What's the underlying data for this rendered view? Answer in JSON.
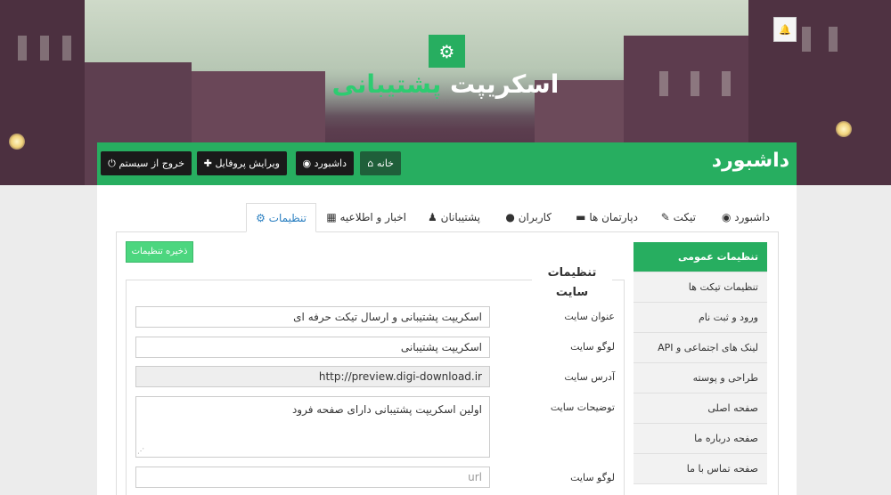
{
  "hero": {
    "gear_icon": "gear-icon",
    "title_main": "اسکریپت",
    "title_accent": "پشتیبانی",
    "bell_icon": "bell-icon"
  },
  "header": {
    "title": "داشبورد",
    "buttons": [
      {
        "label": "خانه",
        "icon": "home-icon",
        "glyph": "⌂"
      },
      {
        "label": "داشبورد",
        "icon": "dashboard-icon",
        "glyph": "◉"
      },
      {
        "label": "ویرایش پروفایل",
        "icon": "user-plus-icon",
        "glyph": "✚"
      },
      {
        "label": "خروج از سیستم",
        "icon": "power-icon",
        "glyph": "⏻"
      }
    ]
  },
  "tabs": [
    {
      "label": "داشبورد",
      "icon": "dashboard-icon",
      "glyph": "◉"
    },
    {
      "label": "تیکت",
      "icon": "ticket-icon",
      "glyph": "✎"
    },
    {
      "label": "دپارتمان ها",
      "icon": "folder-icon",
      "glyph": "▬"
    },
    {
      "label": "کاربران",
      "icon": "user-icon",
      "glyph": "●"
    },
    {
      "label": "پشتیبانان",
      "icon": "support-agent-icon",
      "glyph": "♟"
    },
    {
      "label": "اخبار و اطلاعیه",
      "icon": "cubes-icon",
      "glyph": "▦"
    },
    {
      "label": "تنظیمات",
      "icon": "gear-icon",
      "glyph": "⚙"
    }
  ],
  "sidebar": {
    "items": [
      {
        "label": "تنظیمات عمومی",
        "active": true
      },
      {
        "label": "تنظیمات تیکت ها"
      },
      {
        "label": "ورود و ثبت نام"
      },
      {
        "label": "لینک های اجتماعی و API"
      },
      {
        "label": "طراحی و پوسته"
      },
      {
        "label": "صفحه اصلی"
      },
      {
        "label": "صفحه درباره ما"
      },
      {
        "label": "صفحه تماس با ما"
      }
    ]
  },
  "form": {
    "save_label": "ذخیره تنظیمات",
    "legend": "تنظیمات سایت",
    "fields": [
      {
        "label": "عنوان سایت",
        "value": "اسکریپت پشتیبانی و ارسال تیکت حرفه ای"
      },
      {
        "label": "لوگو سایت",
        "value": "اسکریپت پشتیبانی"
      },
      {
        "label": "آدرس سایت",
        "value": "http://preview.digi-download.ir"
      },
      {
        "label": "توضیحات سایت",
        "value": "اولین اسکریپت پشتیبانی دارای صفحه فرود"
      },
      {
        "label": "لوگو سایت",
        "placeholder": "url"
      }
    ]
  },
  "colors": {
    "accent": "#27ae60",
    "tab_active": "#2a7fc1"
  }
}
